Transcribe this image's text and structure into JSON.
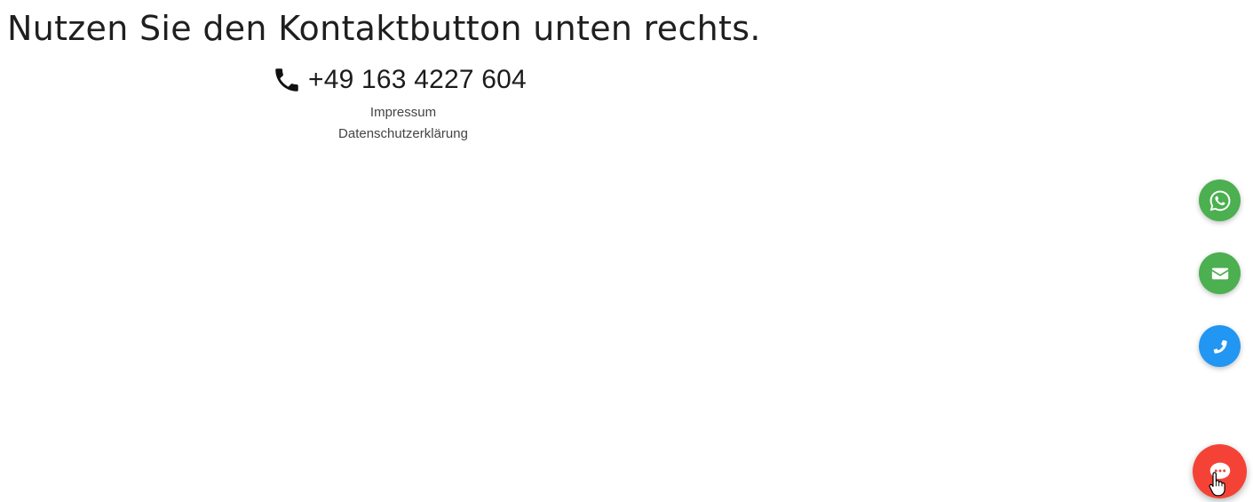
{
  "page": {
    "heading": "Nutzen Sie den Kontaktbutton unten rechts."
  },
  "contact": {
    "phone_icon": "phone-icon",
    "phone_number": "+49 163 4227 604"
  },
  "footer": {
    "links": [
      {
        "label": "Impressum"
      },
      {
        "label": "Datenschutzerklärung"
      }
    ]
  },
  "floating_buttons": {
    "whatsapp": {
      "icon": "whatsapp-icon",
      "color": "#4caf50"
    },
    "email": {
      "icon": "envelope-icon",
      "color": "#4caf50"
    },
    "phone": {
      "icon": "phone-icon",
      "color": "#2196f3"
    },
    "chat": {
      "icon": "chat-bubble-icon",
      "color": "#f44336"
    }
  }
}
